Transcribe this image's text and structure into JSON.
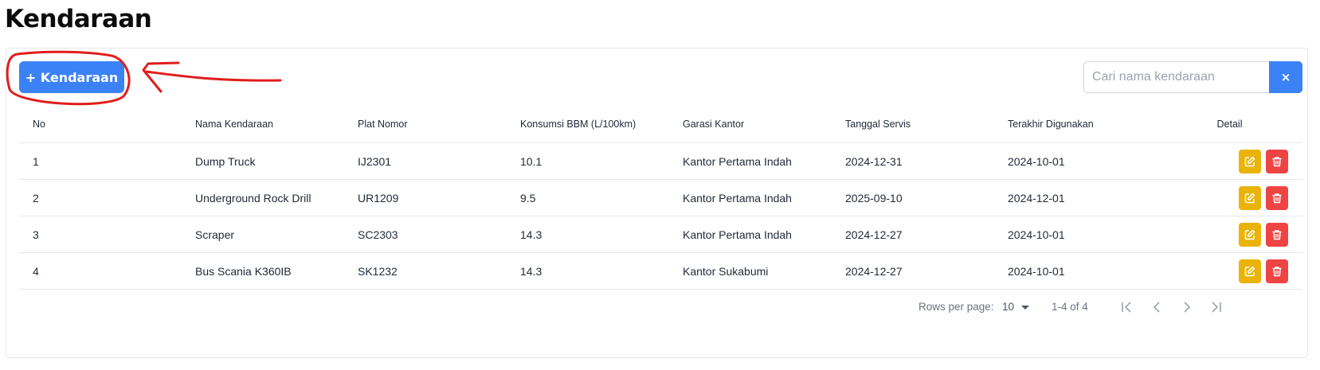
{
  "page": {
    "title": "Kendaraan"
  },
  "toolbar": {
    "add_label": "+ Kendaraan"
  },
  "search": {
    "placeholder": "Cari nama kendaraan",
    "clear_label": "×"
  },
  "table": {
    "headers": [
      "No",
      "Nama Kendaraan",
      "Plat Nomor",
      "Konsumsi BBM (L/100km)",
      "Garasi Kantor",
      "Tanggal Servis",
      "Terakhir Digunakan",
      "Detail"
    ],
    "rows": [
      [
        "1",
        "Dump Truck",
        "IJ2301",
        "10.1",
        "Kantor Pertama Indah",
        "2024-12-31",
        "2024-10-01"
      ],
      [
        "2",
        "Underground Rock Drill",
        "UR1209",
        "9.5",
        "Kantor Pertama Indah",
        "2025-09-10",
        "2024-12-01"
      ],
      [
        "3",
        "Scraper",
        "SC2303",
        "14.3",
        "Kantor Pertama Indah",
        "2024-12-27",
        "2024-10-01"
      ],
      [
        "4",
        "Bus Scania K360IB",
        "SK1232",
        "14.3",
        "Kantor Sukabumi",
        "2024-12-27",
        "2024-10-01"
      ]
    ],
    "row_actions": [
      "edit-icon",
      "trash-icon"
    ]
  },
  "pagination": {
    "rows_per_page_label": "Rows per page:",
    "rows_per_page_value": "10",
    "range_text": "1-4 of 4",
    "nav_icons": [
      "first-page-icon",
      "previous-page-icon",
      "next-page-icon",
      "last-page-icon"
    ]
  },
  "colors": {
    "primary": "#3b82f6",
    "edit": "#eab308",
    "delete": "#ef4444",
    "annotation": "#e11d1d"
  }
}
